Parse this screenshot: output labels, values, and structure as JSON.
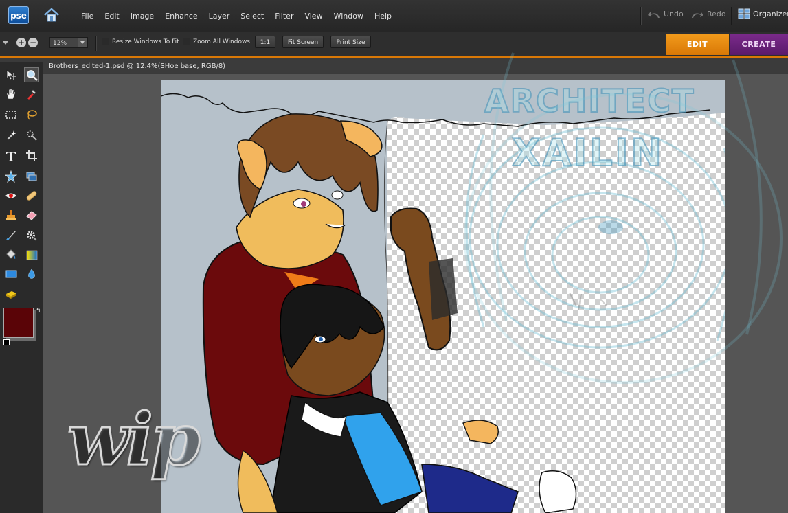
{
  "app": {
    "logo_text": "pse",
    "menu": [
      "File",
      "Edit",
      "Image",
      "Enhance",
      "Layer",
      "Select",
      "Filter",
      "View",
      "Window",
      "Help"
    ],
    "undo_label": "Undo",
    "redo_label": "Redo",
    "organizer_label": "Organizer"
  },
  "options": {
    "zoom_value": "12%",
    "resize_windows_label": "Resize Windows To Fit",
    "zoom_all_label": "Zoom All Windows",
    "actual_pixels_label": "1:1",
    "fit_screen_label": "Fit Screen",
    "print_size_label": "Print Size",
    "resize_windows_checked": false,
    "zoom_all_checked": false
  },
  "mode_tabs": {
    "edit_label": "EDIT",
    "create_label": "CREATE",
    "active": "EDIT"
  },
  "document": {
    "title": "Brothers_edited-1.psd @ 12.4%(SHoe base, RGB/8)"
  },
  "canvas_overlay": {
    "wip_text": "wip",
    "watermark_line1": "ARCHITECT",
    "watermark_line2": "XAILIN"
  },
  "colors": {
    "foreground": "#5a0407",
    "background": "#6a6a6a",
    "edit_tab": "#e88a10",
    "create_tab": "#6a2278"
  },
  "tools": [
    "move-tool",
    "zoom-tool",
    "hand-tool",
    "eyedropper-tool",
    "rectangular-marquee-tool",
    "lasso-tool",
    "magic-wand-tool",
    "quick-selection-tool",
    "type-tool",
    "crop-tool",
    "cookie-cutter-tool",
    "straighten-tool",
    "red-eye-tool",
    "spot-healing-tool",
    "clone-stamp-tool",
    "eraser-tool",
    "brush-tool",
    "smart-brush-tool",
    "paint-bucket-tool",
    "gradient-tool",
    "shape-tool",
    "blur-tool",
    "sponge-tool"
  ]
}
